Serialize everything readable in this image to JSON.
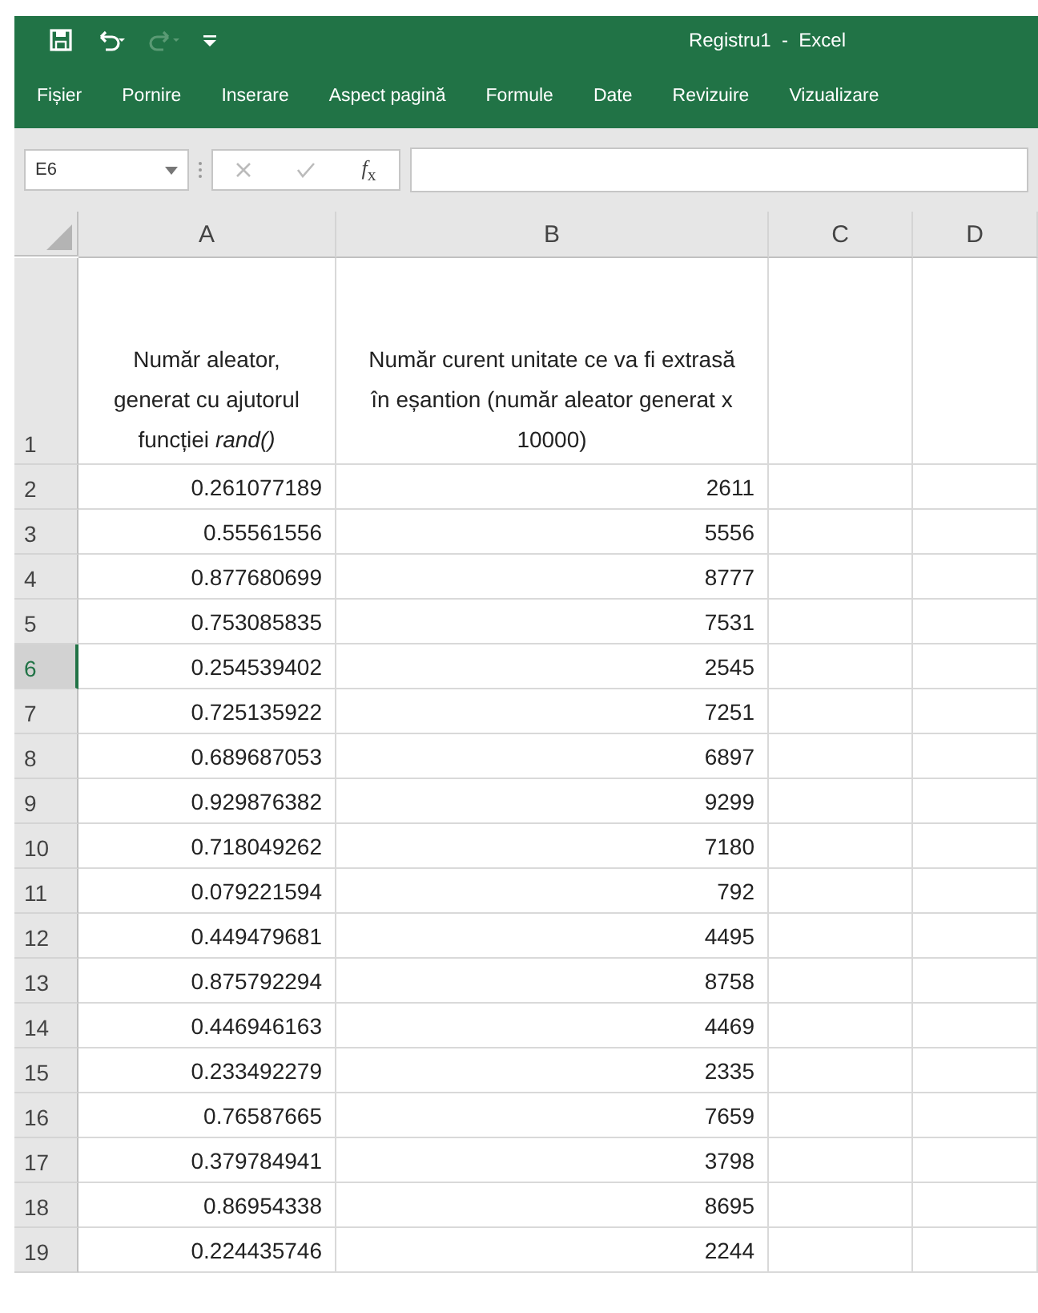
{
  "window": {
    "title": "Registru1  -  Excel"
  },
  "ribbon_tabs": [
    {
      "label": "Fișier"
    },
    {
      "label": "Pornire"
    },
    {
      "label": "Inserare"
    },
    {
      "label": "Aspect pagină"
    },
    {
      "label": "Formule"
    },
    {
      "label": "Date"
    },
    {
      "label": "Revizuire"
    },
    {
      "label": "Vizualizare"
    }
  ],
  "formula_bar": {
    "name_box": "E6",
    "function_label": "*f*$_{x}$"
  },
  "columns": [
    {
      "label": "A"
    },
    {
      "label": "B"
    },
    {
      "label": "C"
    },
    {
      "label": "D"
    }
  ],
  "header_row": {
    "number": "1",
    "cells": [
      "Număr aleator, generat cu ajutorul funcției *rand()*",
      "Număr curent unitate ce va fi extrasă în eșantion (număr aleator generat x 10000)"
    ]
  },
  "rows": [
    {
      "number": "2",
      "selected": false,
      "a": "0.261077189",
      "b": "2611"
    },
    {
      "number": "3",
      "selected": false,
      "a": "0.55561556",
      "b": "5556"
    },
    {
      "number": "4",
      "selected": false,
      "a": "0.877680699",
      "b": "8777"
    },
    {
      "number": "5",
      "selected": false,
      "a": "0.753085835",
      "b": "7531"
    },
    {
      "number": "6",
      "selected": true,
      "a": "0.254539402",
      "b": "2545"
    },
    {
      "number": "7",
      "selected": false,
      "a": "0.725135922",
      "b": "7251"
    },
    {
      "number": "8",
      "selected": false,
      "a": "0.689687053",
      "b": "6897"
    },
    {
      "number": "9",
      "selected": false,
      "a": "0.929876382",
      "b": "9299"
    },
    {
      "number": "10",
      "selected": false,
      "a": "0.718049262",
      "b": "7180"
    },
    {
      "number": "11",
      "selected": false,
      "a": "0.079221594",
      "b": "792"
    },
    {
      "number": "12",
      "selected": false,
      "a": "0.449479681",
      "b": "4495"
    },
    {
      "number": "13",
      "selected": false,
      "a": "0.875792294",
      "b": "8758"
    },
    {
      "number": "14",
      "selected": false,
      "a": "0.446946163",
      "b": "4469"
    },
    {
      "number": "15",
      "selected": false,
      "a": "0.233492279",
      "b": "2335"
    },
    {
      "number": "16",
      "selected": false,
      "a": "0.76587665",
      "b": "7659"
    },
    {
      "number": "17",
      "selected": false,
      "a": "0.379784941",
      "b": "3798"
    },
    {
      "number": "18",
      "selected": false,
      "a": "0.86954338",
      "b": "8695"
    },
    {
      "number": "19",
      "selected": false,
      "a": "0.224435746",
      "b": "2244"
    }
  ]
}
